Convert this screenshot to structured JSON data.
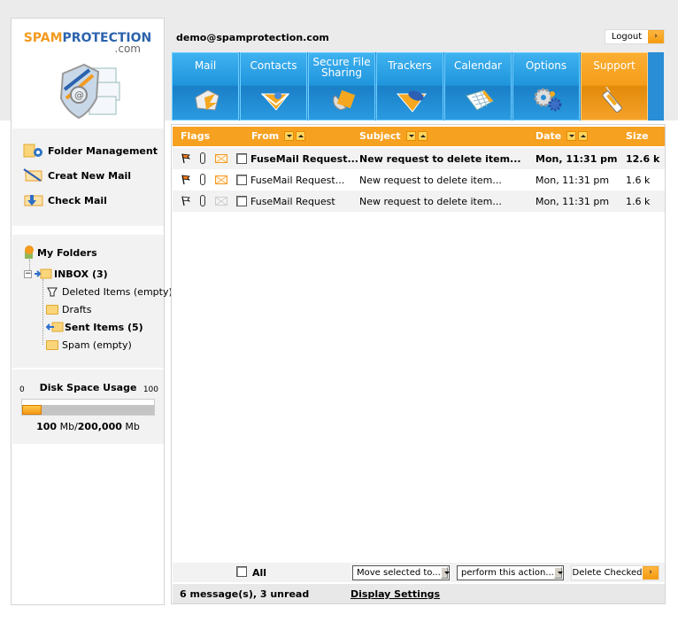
{
  "brand": {
    "name_part1": "SPAM",
    "name_part2": "PROTECTION",
    "domain_suffix": ".com"
  },
  "header": {
    "user_email": "demo@spamprotection.com",
    "logout_label": "Logout",
    "logout_arrow": "›"
  },
  "nav": {
    "tabs": [
      {
        "label": "Mail",
        "icon": "mail-icon"
      },
      {
        "label": "Contacts",
        "icon": "contacts-icon"
      },
      {
        "label": "Secure File Sharing",
        "icon": "file-sharing-icon"
      },
      {
        "label": "Trackers",
        "icon": "trackers-icon"
      },
      {
        "label": "Calendar",
        "icon": "calendar-icon"
      },
      {
        "label": "Options",
        "icon": "options-gear-icon"
      },
      {
        "label": "Support",
        "icon": "support-phone-icon",
        "active": true
      }
    ]
  },
  "sidebar": {
    "actions": [
      {
        "label": "Folder Management",
        "icon": "folder-management-icon"
      },
      {
        "label": "Creat New Mail",
        "icon": "compose-mail-icon"
      },
      {
        "label": "Check Mail",
        "icon": "check-mail-icon"
      }
    ],
    "folders_title": "My Folders",
    "folders": [
      {
        "label": "INBOX (3)",
        "bold": true,
        "icon": "inbox-icon"
      },
      {
        "label": "Deleted Items (empty)",
        "bold": false,
        "icon": "trash-icon"
      },
      {
        "label": "Drafts",
        "bold": false,
        "icon": "folder-icon"
      },
      {
        "label": "Sent Items (5)",
        "bold": true,
        "icon": "sent-icon"
      },
      {
        "label": "Spam (empty)",
        "bold": false,
        "icon": "folder-icon"
      }
    ],
    "disk": {
      "title": "Disk Space Usage",
      "min_label": "0",
      "max_label": "100",
      "used": "100",
      "used_unit": "Mb/",
      "total": "200,000",
      "total_unit": "Mb",
      "usage_fraction": 0.15
    }
  },
  "table": {
    "columns": {
      "flags": "Flags",
      "from": "From",
      "subject": "Subject",
      "date": "Date",
      "size": "Size"
    },
    "rows": [
      {
        "from": "FuseMail Request...",
        "subject": "New request to delete item...",
        "date": "Mon, 11:31 pm",
        "size": "12.6 k",
        "unread": true,
        "flagged": true
      },
      {
        "from": "FuseMail Request...",
        "subject": "New request to delete item...",
        "date": "Mon, 11:31 pm",
        "size": "1.6 k",
        "unread": false,
        "flagged": true
      },
      {
        "from": "FuseMail Request",
        "subject": "New request to delete item...",
        "date": "Mon, 11:31 pm",
        "size": "1.6 k",
        "unread": false,
        "flagged": false
      }
    ]
  },
  "footer": {
    "select_all_label": "All",
    "move_select": "Move selected to...",
    "action_select": "perform this action...",
    "delete_label": "Delete Checked",
    "status": "6 message(s), 3 unread",
    "display_settings": "Display Settings"
  },
  "colors": {
    "accent_orange": "#f7a120",
    "nav_blue": "#2a8ed6"
  }
}
